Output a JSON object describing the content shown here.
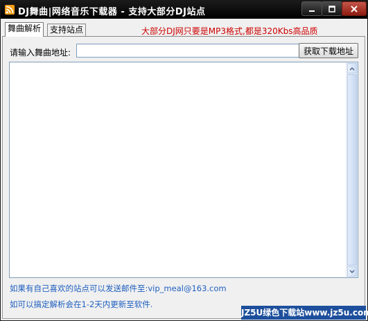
{
  "window": {
    "title": "DJ舞曲|网络音乐下载器 - 支持大部分DJ站点",
    "accent": "#000000"
  },
  "tabs": [
    {
      "label": "舞曲解析",
      "active": true
    },
    {
      "label": "支持站点",
      "active": false
    }
  ],
  "notice": "大部分DJ网只要是MP3格式,都是320Kbs高品质",
  "form": {
    "url_label": "请输入舞曲地址:",
    "url_value": "",
    "fetch_button": "获取下载地址"
  },
  "footer": {
    "line1": "如果有自己喜欢的站点可以发送邮件至:vip_meal@163.com",
    "line2": "如可以搞定解析会在1-2天内更新至软件."
  },
  "watermark": "JZ5U绿色下载站www.jz5u.com",
  "icons": {
    "app": "rss-icon",
    "minimize": "minimize-icon",
    "maximize": "maximize-icon",
    "close": "close-icon"
  }
}
